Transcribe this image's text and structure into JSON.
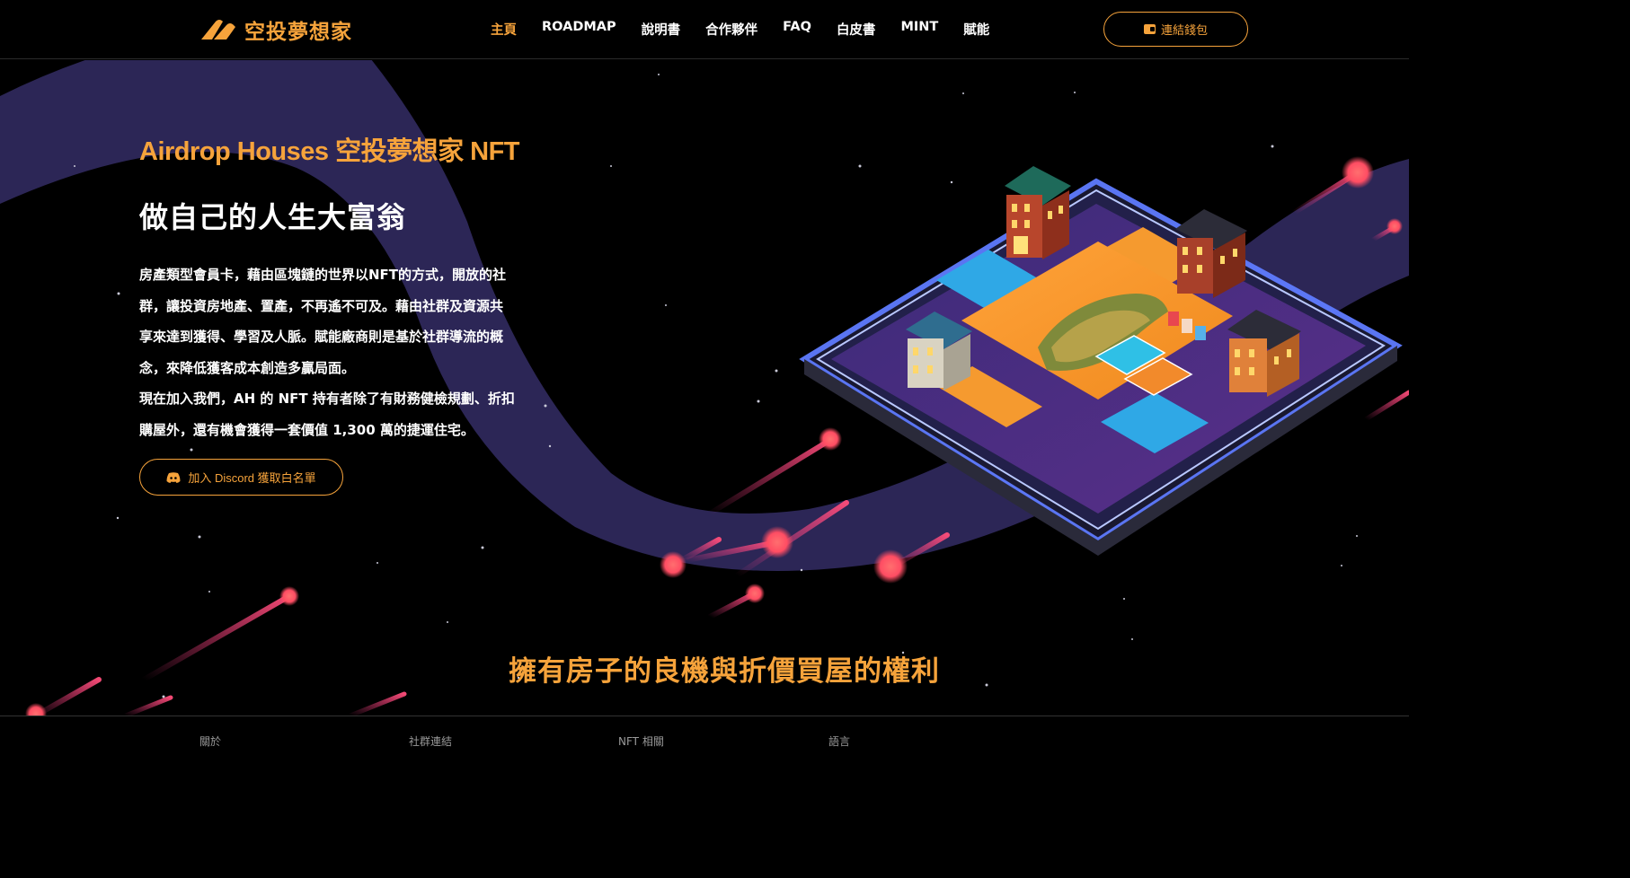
{
  "header": {
    "logo_text": "空投夢想家",
    "nav": [
      {
        "label": "主頁",
        "active": true
      },
      {
        "label": "ROADMAP",
        "active": false
      },
      {
        "label": "說明書",
        "active": false
      },
      {
        "label": "合作夥伴",
        "active": false
      },
      {
        "label": "FAQ",
        "active": false
      },
      {
        "label": "白皮書",
        "active": false
      },
      {
        "label": "MINT",
        "active": false
      },
      {
        "label": "賦能",
        "active": false
      }
    ],
    "wallet_button": "連結錢包",
    "wallet_icon": "wallet-icon"
  },
  "hero": {
    "title": "Airdrop Houses 空投夢想家 NFT",
    "subtitle": "做自己的人生大富翁",
    "body_lines": [
      "房產類型會員卡，藉由區塊鏈的世界以NFT的方式，開放的社",
      "群，讓投資房地產、置產，不再遙不可及。藉由社群及資源共",
      "享來達到獲得、學習及人脈。賦能廠商則是基於社群導流的概",
      "念，來降低獲客成本創造多贏局面。",
      "現在加入我們，AH 的 NFT 持有者除了有財務健檢規劃、折扣",
      "購屋外，還有機會獲得一套價值 1,300 萬的捷運住宅。"
    ],
    "discord_button": "加入 Discord 獲取白名單",
    "discord_icon": "discord-icon",
    "illustration": "isometric-board-illustration"
  },
  "section": {
    "heading": "擁有房子的良機與折價買屋的權利"
  },
  "footer": {
    "columns": [
      "關於",
      "社群連結",
      "NFT 相關",
      "語言"
    ]
  },
  "colors": {
    "accent": "#f6a33b",
    "background": "#000000",
    "wave": "#2c2656",
    "meteor": "#ff5a6e"
  }
}
